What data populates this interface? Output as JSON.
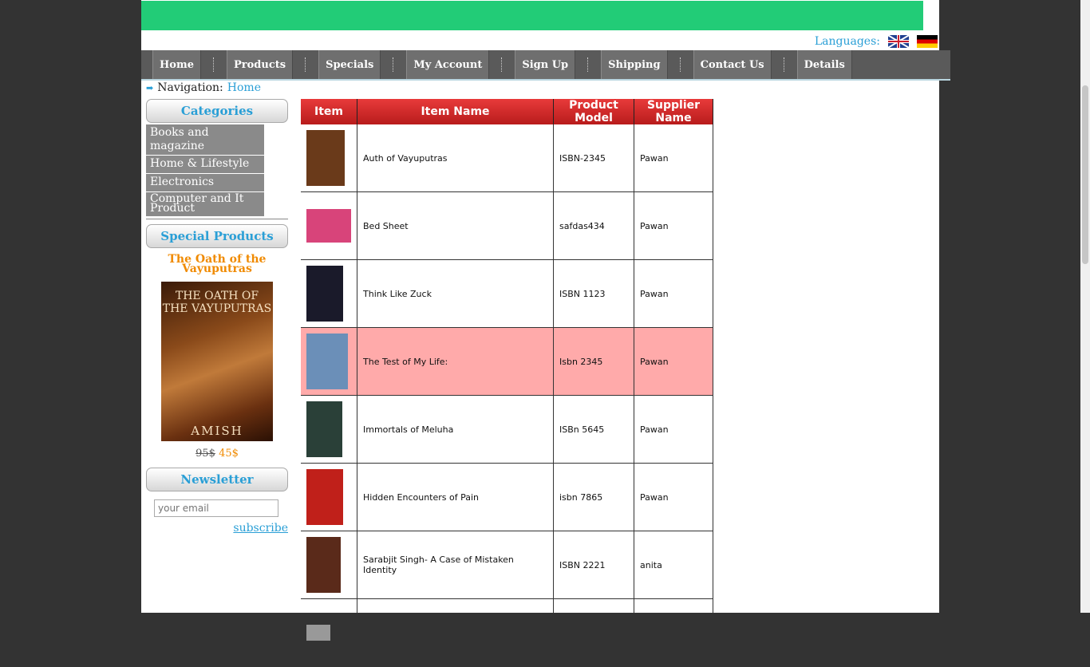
{
  "header": {
    "languages_label": "Languages:",
    "flags": [
      "uk-flag-icon",
      "germany-flag-icon"
    ]
  },
  "nav": {
    "items": [
      {
        "label": "Home"
      },
      {
        "label": "Products"
      },
      {
        "label": "Specials"
      },
      {
        "label": "My Account"
      },
      {
        "label": "Sign Up"
      },
      {
        "label": "Shipping"
      },
      {
        "label": "Contact Us"
      },
      {
        "label": "Details"
      }
    ]
  },
  "breadcrumb": {
    "prefix": "Navigation:",
    "link": "Home"
  },
  "sidebar": {
    "categories_title": "Categories",
    "categories": [
      "Books and magazine",
      "Home & Lifestyle",
      "Electronics",
      "Computer and It Product"
    ],
    "special_title": "Special Products",
    "special_product": {
      "name": "The Oath of the Vayuputras",
      "cover_title": "THE OATH OF THE VAYUPUTRAS",
      "cover_author": "AMISH",
      "old_price": "95$",
      "new_price": "45$"
    },
    "newsletter_title": "Newsletter",
    "email_placeholder": "your email",
    "subscribe_label": "subscribe"
  },
  "table": {
    "headers": [
      "Item",
      "Item Name",
      "Product Model",
      "Supplier Name"
    ],
    "rows": [
      {
        "name": "Auth of Vayuputras",
        "model": "ISBN-2345",
        "supplier": "Pawan",
        "thumb_color": "#6a3a1a",
        "thumb_w": 48,
        "thumb_h": 70
      },
      {
        "name": "Bed Sheet",
        "model": "safdas434",
        "supplier": "Pawan",
        "thumb_color": "#d8447a",
        "thumb_w": 56,
        "thumb_h": 42
      },
      {
        "name": "Think Like Zuck",
        "model": "ISBN 1123",
        "supplier": "Pawan",
        "thumb_color": "#1a1a2a",
        "thumb_w": 46,
        "thumb_h": 70
      },
      {
        "name": "The Test of My Life:",
        "model": "Isbn 2345",
        "supplier": "Pawan",
        "thumb_color": "#6b8fb8",
        "thumb_w": 52,
        "thumb_h": 70,
        "highlight": true
      },
      {
        "name": "Immortals of Meluha",
        "model": "ISBn 5645",
        "supplier": "Pawan",
        "thumb_color": "#2a4038",
        "thumb_w": 45,
        "thumb_h": 70
      },
      {
        "name": "Hidden Encounters of Pain",
        "model": "isbn 7865",
        "supplier": "Pawan",
        "thumb_color": "#c0201a",
        "thumb_w": 46,
        "thumb_h": 70
      },
      {
        "name": "Sarabjit Singh- A Case of Mistaken Identity",
        "model": "ISBN 2221",
        "supplier": "anita",
        "thumb_color": "#5a2a1a",
        "thumb_w": 43,
        "thumb_h": 70
      },
      {
        "name": "",
        "model": "",
        "supplier": "",
        "thumb_color": "#999999",
        "thumb_w": 30,
        "thumb_h": 20
      }
    ]
  }
}
